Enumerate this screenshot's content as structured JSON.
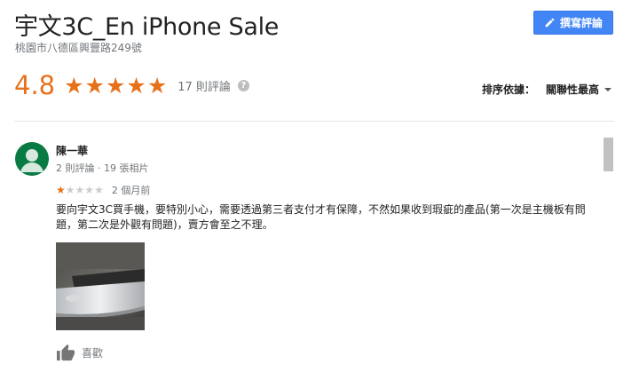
{
  "header": {
    "title": "宇文3C_En iPhone Sale",
    "address": "桃園市八德區興豐路249號",
    "write_review_label": "撰寫評論"
  },
  "rating": {
    "value": "4.8",
    "stars_filled": 5,
    "review_count_label": "17 則評論",
    "help_icon": "question-icon"
  },
  "sort": {
    "label": "排序依據：",
    "value": "關聯性最高"
  },
  "reviews": [
    {
      "name": "陳一華",
      "meta": "2 則評論 · 19 張相片",
      "stars": 1,
      "max_stars": 5,
      "date": "2 個月前",
      "text": "要向宇文3C買手機，要特別小心，需要透過第三者支付才有保障，不然如果收到瑕疵的產品(第一次是主機板有問題，第二次是外觀有問題)，賣方會至之不理。",
      "like_label": "喜歡"
    }
  ],
  "colors": {
    "accent_orange": "#e7711b",
    "button_blue": "#4285f4",
    "avatar_green": "#0a7a45",
    "muted_text": "#70757a"
  }
}
